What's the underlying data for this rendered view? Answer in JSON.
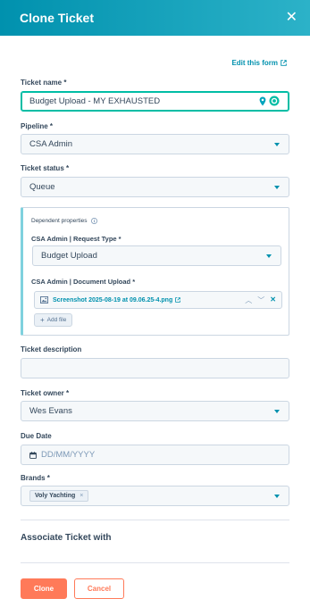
{
  "header": {
    "title": "Clone Ticket"
  },
  "edit_form_link": "Edit this form",
  "ticket_name": {
    "label": "Ticket name *",
    "value": "Budget Upload - MY EXHAUSTED"
  },
  "pipeline": {
    "label": "Pipeline *",
    "value": "CSA Admin"
  },
  "ticket_status": {
    "label": "Ticket status *",
    "value": "Queue"
  },
  "dependent": {
    "title": "Dependent properties",
    "request_type": {
      "label": "CSA Admin | Request Type *",
      "value": "Budget Upload"
    },
    "document_upload": {
      "label": "CSA Admin | Document Upload *",
      "file_name": "Screenshot 2025-08-19 at 09.06.25-4.png",
      "add_file_label": "Add file"
    }
  },
  "ticket_description": {
    "label": "Ticket description",
    "value": ""
  },
  "ticket_owner": {
    "label": "Ticket owner *",
    "value": "Wes Evans"
  },
  "due_date": {
    "label": "Due Date",
    "placeholder": "DD/MM/YYYY"
  },
  "brands": {
    "label": "Brands *",
    "tags": [
      "Voly Yachting"
    ]
  },
  "associate": {
    "title": "Associate Ticket with"
  },
  "footer": {
    "clone_label": "Clone",
    "cancel_label": "Cancel"
  },
  "colors": {
    "header_start": "#0091ae",
    "header_end": "#2cb2c8",
    "primary": "#ff7a59",
    "link": "#0091ae",
    "focus": "#00bda5"
  }
}
